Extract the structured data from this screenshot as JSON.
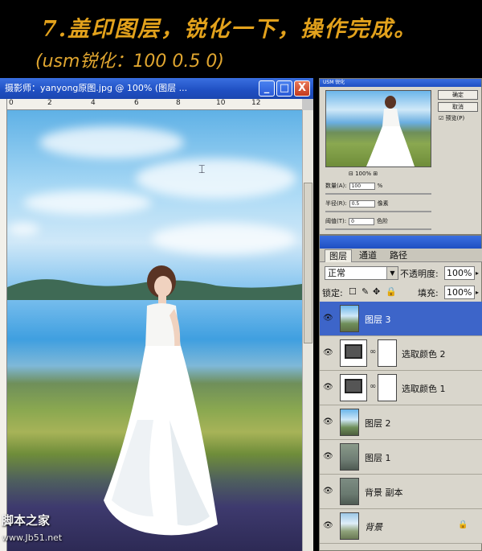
{
  "banner": {
    "title": "7.盖印图层，锐化一下，操作完成。",
    "subtitle": "(usm锐化：100 0.5 0)"
  },
  "document_window": {
    "title": "摄影师：yanyong原图.jpg @ 100% (图层 ...",
    "ruler_ticks": [
      "0",
      "2",
      "4",
      "6",
      "8",
      "10",
      "12"
    ],
    "buttons": {
      "minimize": "_",
      "maximize": "□",
      "close": "X"
    }
  },
  "usm_dialog": {
    "title": "USM 锐化",
    "ok_label": "确定",
    "cancel_label": "取消",
    "preview_label": "预览(P)",
    "zoom": "100%",
    "amount_label": "数量(A):",
    "amount_value": "100",
    "amount_unit": "%",
    "radius_label": "半径(R):",
    "radius_value": "0.5",
    "radius_unit": "像素",
    "threshold_label": "阈值(T):",
    "threshold_value": "0",
    "threshold_unit": "色阶"
  },
  "layers_panel": {
    "tabs": [
      "图层",
      "通道",
      "路径"
    ],
    "blend_mode": "正常",
    "opacity_label": "不透明度:",
    "opacity_value": "100%",
    "lock_label": "锁定:",
    "fill_label": "填充:",
    "fill_value": "100%",
    "layers": [
      {
        "name": "图层 3",
        "type": "image",
        "selected": true
      },
      {
        "name": "选取颜色 2",
        "type": "adjustment",
        "selected": false
      },
      {
        "name": "选取颜色 1",
        "type": "adjustment",
        "selected": false
      },
      {
        "name": "图层 2",
        "type": "image",
        "selected": false
      },
      {
        "name": "图层 1",
        "type": "image",
        "selected": false
      },
      {
        "name": "背景 副本",
        "type": "image",
        "selected": false
      },
      {
        "name": "背景",
        "type": "background",
        "selected": false
      }
    ]
  },
  "watermark": {
    "site": "脚本之家",
    "url": "www.Jb51.net"
  }
}
